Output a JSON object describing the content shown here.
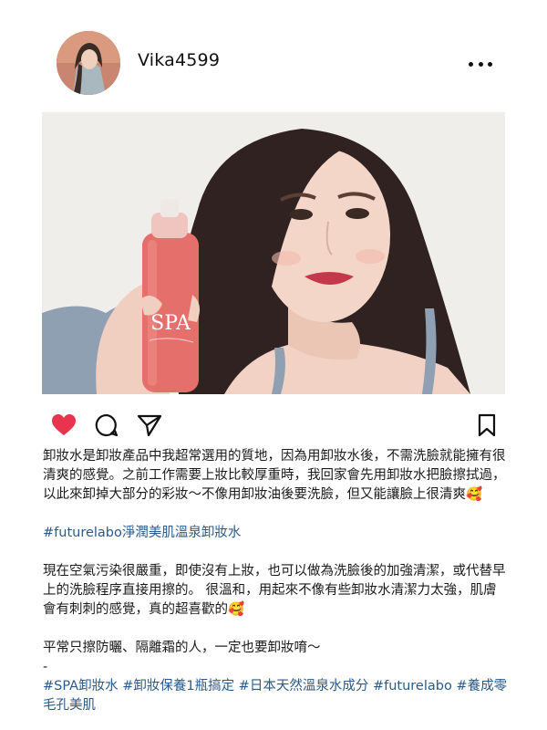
{
  "post": {
    "username": "Vika4599",
    "more_icon": "more-horizontal-icon",
    "colors": {
      "heart": "#e8344e",
      "hashtag": "#2a5a8a",
      "text": "#1a1a1a"
    }
  },
  "photo": {
    "bottle_label": "SPA"
  },
  "actions": {
    "like_icon": "heart-icon",
    "comment_icon": "comment-icon",
    "share_icon": "send-icon",
    "save_icon": "bookmark-icon"
  },
  "caption": {
    "paragraph1": "卸妝水是卸妝產品中我超常選用的質地，因為用卸妝水後，不需洗臉就能擁有很清爽的感覺。之前工作需要上妝比較厚重時，我回家會先用卸妝水把臉擦拭過，以此來卸掉大部分的彩妝～不像用卸妝油後要洗臉，但又能讓臉上很清爽🥰",
    "hashtag_line1": "#futurelabo淨潤美肌溫泉卸妝水",
    "paragraph2": "現在空氣污染很嚴重，即使沒有上妝，也可以做為洗臉後的加強清潔，或代替早上的洗臉程序直接用擦的。 很溫和，用起來不像有些卸妝水清潔力太強，肌膚會有刺刺的感覺，真的超喜歡的🥰",
    "paragraph3": "平常只擦防曬、隔離霜的人，一定也要卸妝唷～",
    "separator": "-",
    "hashtags_final": "#SPA卸妝水 #卸妝保養1瓶搞定 #日本天然溫泉水成分 #futurelabo #養成零毛孔美肌"
  }
}
